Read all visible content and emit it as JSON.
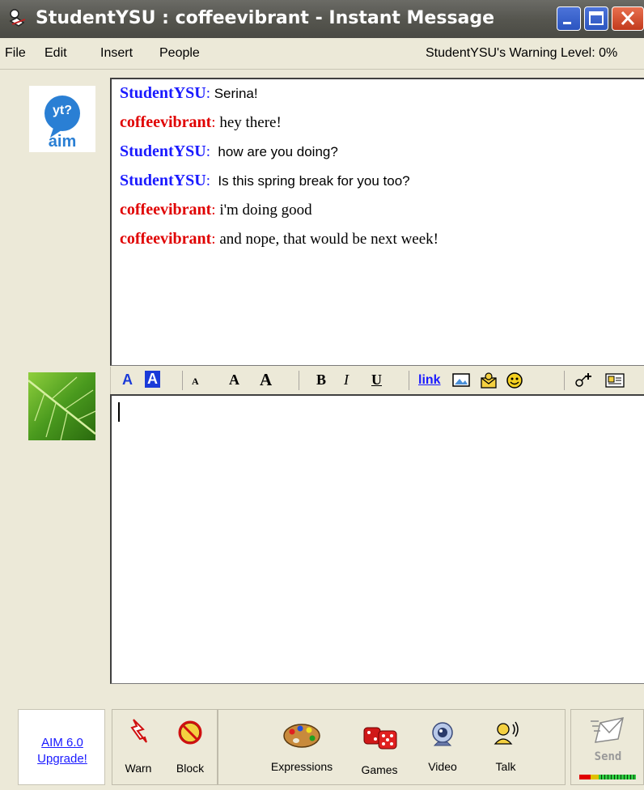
{
  "window": {
    "title": "StudentYSU : coffeevibrant - Instant Message"
  },
  "menu": {
    "file": "File",
    "edit": "Edit",
    "insert": "Insert",
    "people": "People",
    "warning_level": "StudentYSU's Warning Level: 0%"
  },
  "logo": {
    "line1": "yt?",
    "line2": "aim"
  },
  "transcript": [
    {
      "sender": "StudentYSU",
      "text": " Serina!",
      "color": "#1a1aff"
    },
    {
      "sender": "coffeevibrant",
      "text": " hey there!",
      "color": "#e00000"
    },
    {
      "sender": "StudentYSU",
      "text": "  how are you doing?",
      "color": "#1a1aff"
    },
    {
      "sender": "StudentYSU",
      "text": "  Is this spring break for you too?",
      "color": "#1a1aff"
    },
    {
      "sender": "coffeevibrant",
      "text": " i'm doing good",
      "color": "#e00000"
    },
    {
      "sender": "coffeevibrant",
      "text": " and nope, that would be next week!",
      "color": "#e00000"
    }
  ],
  "format_toolbar": {
    "text_color": "A",
    "bg_color": "A",
    "smaller": "A",
    "normal": "A",
    "larger": "A",
    "bold": "B",
    "italic": "I",
    "underline": "U",
    "link": "link"
  },
  "compose": {
    "value": ""
  },
  "upgrade": {
    "line1": "AIM 6.0",
    "line2": "Upgrade!"
  },
  "buttons": {
    "warn": "Warn",
    "block": "Block",
    "expressions": "Expressions",
    "games": "Games",
    "video": "Video",
    "talk": "Talk",
    "send": "Send"
  }
}
